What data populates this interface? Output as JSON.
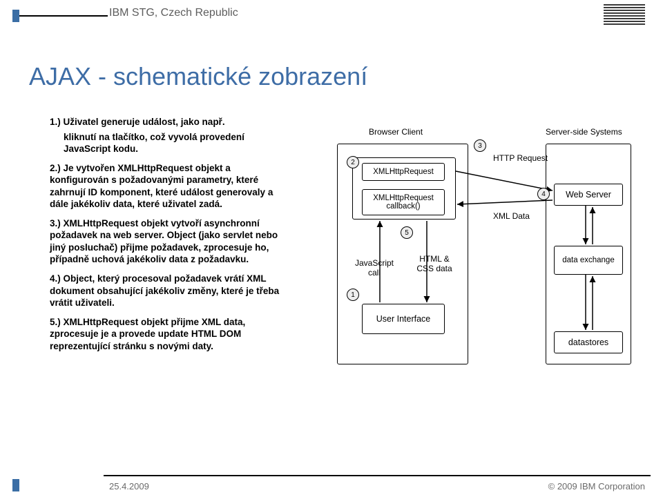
{
  "header": {
    "org": "IBM STG, Czech Republic",
    "logo_name": "ibm-logo"
  },
  "title": "AJAX - schematické zobrazení",
  "body": {
    "p1a": "1.) Uživatel generuje událost, jako např.",
    "p1b": "kliknutí na tlačítko, což vyvolá provedení JavaScript kodu.",
    "p2": "2.) Je vytvořen  XMLHttpRequest objekt a konfigurován s požadovanými parametry, které zahrnují ID komponent, které událost generovaly a dále jakékoliv data, které uživatel zadá.",
    "p3": "3.) XMLHttpRequest objekt vytvoří asynchronní požadavek na web server. Object (jako servlet nebo jiný posluchač) přijme požadavek, zprocesuje ho, případně uchová jakékoliv data z požadavku.",
    "p4": "4.) Object, který procesoval požadavek vrátí XML dokument obsahující jakékoliv změny, které je třeba vrátit uživateli.",
    "p5": "5.) XMLHttpRequest objekt přijme XML data, zprocesuje je a provede update HTML DOM reprezentující stránku s novými daty."
  },
  "diagram": {
    "browser_client": "Browser Client",
    "server_side": "Server-side Systems",
    "xhr_box": "XMLHttpRequest",
    "xhr_cb": "XMLHttpRequest callback()",
    "user_interface": "User Interface",
    "web_server": "Web Server",
    "data_exchange": "data exchange",
    "datastores": "datastores",
    "http_request": "HTTP Request",
    "xml_data": "XML Data",
    "js_call": "JavaScript call",
    "html_css": "HTML & CSS data",
    "n1": "1",
    "n2": "2",
    "n3": "3",
    "n4": "4",
    "n5": "5"
  },
  "footer": {
    "date": "25.4.2009",
    "copyright": "© 2009 IBM Corporation"
  }
}
